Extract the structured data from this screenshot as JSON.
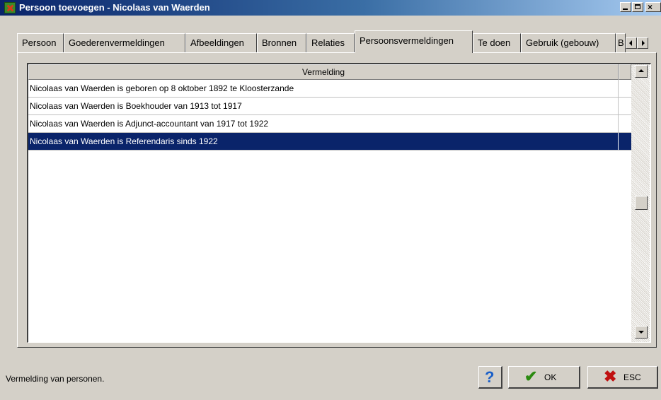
{
  "window": {
    "title": "Persoon toevoegen - Nicolaas van Waerden",
    "minimize_label": "minimize",
    "maximize_label": "maximize",
    "close_glyph": "×"
  },
  "tabs": [
    {
      "label": "Persoon",
      "active": false
    },
    {
      "label": "Goederenvermeldingen",
      "active": false
    },
    {
      "label": "Afbeeldingen",
      "active": false
    },
    {
      "label": "Bronnen",
      "active": false
    },
    {
      "label": "Relaties",
      "active": false
    },
    {
      "label": "Persoonsvermeldingen",
      "active": true
    },
    {
      "label": "Te doen",
      "active": false
    },
    {
      "label": "Gebruik (gebouw)",
      "active": false
    },
    {
      "label": "B",
      "active": false
    }
  ],
  "grid": {
    "column_header": "Vermelding",
    "rows": [
      "Nicolaas van Waerden is geboren op 8 oktober 1892 te Kloosterzande",
      "Nicolaas van Waerden is Boekhouder van 1913 tot 1917",
      "Nicolaas van Waerden is Adjunct-accountant van 1917 tot 1922",
      "Nicolaas van Waerden is Referendaris sinds 1922"
    ],
    "selected_row": 3
  },
  "status": {
    "text": "Vermelding van personen."
  },
  "buttons": {
    "help_glyph": "?",
    "ok_glyph": "✔",
    "ok_label": "OK",
    "esc_glyph": "✖",
    "esc_label": "ESC"
  },
  "colors": {
    "selection": "#0a246a",
    "title_gradient_start": "#0a246a",
    "title_gradient_end": "#a6caf0",
    "face": "#d4d0c8"
  }
}
